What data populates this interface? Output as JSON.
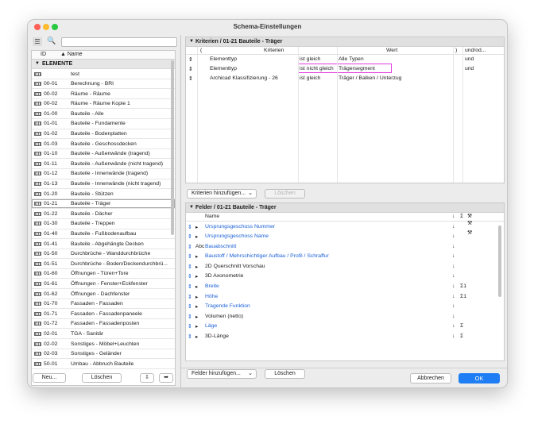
{
  "window": {
    "title": "Schema-Einstellungen",
    "traffic_colors": [
      "#fe5f57",
      "#febc2e",
      "#28c840"
    ]
  },
  "left_panel": {
    "search_placeholder": "",
    "header": {
      "id": "ID",
      "name": "▲ Name"
    },
    "group": {
      "label": "ELEMENTE"
    },
    "rows": [
      {
        "id": "",
        "name": "test"
      },
      {
        "id": "00-01",
        "name": "Berechnung - BRI"
      },
      {
        "id": "00-02",
        "name": "Räume - Räume"
      },
      {
        "id": "00-02",
        "name": "Räume - Räume Kopie 1"
      },
      {
        "id": "01-00",
        "name": "Bauteile - Alle"
      },
      {
        "id": "01-01",
        "name": "Bauteile - Fundamente"
      },
      {
        "id": "01-02",
        "name": "Bauteile - Bodenplatten"
      },
      {
        "id": "01-03",
        "name": "Bauteile - Geschossdecken"
      },
      {
        "id": "01-10",
        "name": "Bauteile - Außenwände (tragend)"
      },
      {
        "id": "01-11",
        "name": "Bauteile - Außenwände (nicht tragend)"
      },
      {
        "id": "01-12",
        "name": "Bauteile - Innenwände (tragend)"
      },
      {
        "id": "01-13",
        "name": "Bauteile - Innenwände (nicht tragend)"
      },
      {
        "id": "01-20",
        "name": "Bauteile - Stützen"
      },
      {
        "id": "01-21",
        "name": "Bauteile - Träger",
        "selected": true
      },
      {
        "id": "01-22",
        "name": "Bauteile - Dächer"
      },
      {
        "id": "01-30",
        "name": "Bauteile - Treppen"
      },
      {
        "id": "01-40",
        "name": "Bauteile - Fußbodenaufbau"
      },
      {
        "id": "01-41",
        "name": "Bauteile - Abgehängte Decken"
      },
      {
        "id": "01-50",
        "name": "Durchbrüche - Wanddurchbrüche"
      },
      {
        "id": "01-51",
        "name": "Durchbrüche - Boden/Deckendurchbrü..."
      },
      {
        "id": "01-60",
        "name": "Öffnungen - Türen+Tore"
      },
      {
        "id": "01-61",
        "name": "Öffnungen - Fenster+Eckfenster"
      },
      {
        "id": "01-62",
        "name": "Öffnungen - Dachfenster"
      },
      {
        "id": "01-70",
        "name": "Fassaden - Fassaden"
      },
      {
        "id": "01-71",
        "name": "Fassaden - Fassadenpaneele"
      },
      {
        "id": "01-72",
        "name": "Fassaden - Fassadenposten"
      },
      {
        "id": "02-01",
        "name": "TGA - Sanitär"
      },
      {
        "id": "02-02",
        "name": "Sonstiges - Möbel+Leuchten"
      },
      {
        "id": "02-03",
        "name": "Sonstiges - Geländer"
      },
      {
        "id": "50-01",
        "name": "Umbau - Abbruch Bauteile"
      }
    ],
    "buttons": {
      "new": "Neu...",
      "delete": "Löschen"
    }
  },
  "criteria": {
    "header": "Kriterien / 01-21 Bauteile - Träger",
    "columns": {
      "paren_open": "(",
      "criterion": "Kriterien",
      "value": "Wert",
      "paren_close": ")",
      "and_or": "und/od..."
    },
    "rows": [
      {
        "criterion": "Elementtyp",
        "operator": "ist gleich",
        "value": "Alle Typen",
        "and_or": "und"
      },
      {
        "criterion": "Elementtyp",
        "operator": "ist nicht gleich",
        "value": "Trägersegment",
        "and_or": "und",
        "highlighted": true
      },
      {
        "criterion": "Archicad Klassifizierung - 26",
        "operator": "ist gleich",
        "value": "Träger / Balken / Unterzug",
        "and_or": ""
      }
    ],
    "add_label": "Kriterien hinzufügen...",
    "delete_label": "Löschen"
  },
  "fields": {
    "header": "Felder / 01-21 Bauteile - Träger",
    "columns": {
      "name": "Name",
      "sort": "↓",
      "sum": "Σ"
    },
    "rows": [
      {
        "type": "▸",
        "name": "Ursprungsgeschoss Nummer",
        "blue": true,
        "arrow": "↓",
        "sigma": ""
      },
      {
        "type": "▸",
        "name": "Ursprungsgeschoss Name",
        "blue": true,
        "arrow": "↓",
        "sigma": ""
      },
      {
        "type": "Abc",
        "name": "Bauabschnitt",
        "blue": true,
        "arrow": "↓",
        "sigma": ""
      },
      {
        "type": "▸",
        "name": "Baustoff / Mehrschichtiger Aufbau / Profil / Schraffur",
        "blue": true,
        "arrow": "↓",
        "sigma": ""
      },
      {
        "type": "▸",
        "name": "2D Querschnitt Vorschau",
        "blue": false,
        "arrow": "↓",
        "sigma": ""
      },
      {
        "type": "▸",
        "name": "3D Axonometrie",
        "blue": false,
        "arrow": "↓",
        "sigma": ""
      },
      {
        "type": "▸",
        "name": "Breite",
        "blue": true,
        "arrow": "↓",
        "sigma": "Σ1"
      },
      {
        "type": "▸",
        "name": "Höhe",
        "blue": true,
        "arrow": "↓",
        "sigma": "Σ1"
      },
      {
        "type": "▸",
        "name": "Tragende Funktion",
        "blue": true,
        "arrow": "↓",
        "sigma": ""
      },
      {
        "type": "▸",
        "name": "Volumen (netto)",
        "blue": false,
        "arrow": "↓",
        "sigma": ""
      },
      {
        "type": "▸",
        "name": "Läge",
        "blue": true,
        "arrow": "↓",
        "sigma": "Σ"
      },
      {
        "type": "▸",
        "name": "3D-Länge",
        "blue": false,
        "arrow": "↓",
        "sigma": "Σ"
      }
    ],
    "add_label": "Felder hinzufügen...",
    "delete_label": "Löschen"
  },
  "footer": {
    "cancel": "Abbrechen",
    "ok": "OK"
  }
}
